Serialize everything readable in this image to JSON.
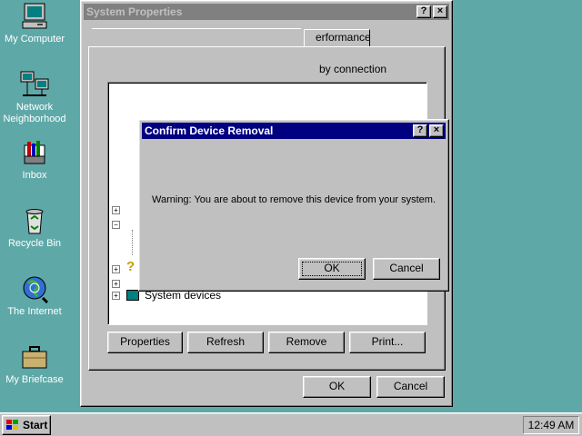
{
  "desktop": {
    "icons": [
      {
        "name": "computer-icon",
        "label": "My Computer"
      },
      {
        "name": "network-icon",
        "label": "Network\nNeighborhood"
      },
      {
        "name": "inbox-icon",
        "label": "Inbox"
      },
      {
        "name": "recycle-bin-icon",
        "label": "Recycle Bin"
      },
      {
        "name": "internet-icon",
        "label": "The Internet"
      },
      {
        "name": "briefcase-icon",
        "label": "My Briefcase"
      }
    ]
  },
  "system_properties": {
    "title": "System Properties",
    "help_btn": "?",
    "close_btn": "×",
    "tab_label": "erformance",
    "sort_text": "by connection",
    "tree_item": "System devices",
    "buttons": {
      "properties": "Properties",
      "refresh": "Refresh",
      "remove": "Remove",
      "print": "Print..."
    },
    "ok": "OK",
    "cancel": "Cancel",
    "partial_label": "S"
  },
  "confirm_dialog": {
    "title": "Confirm Device Removal",
    "help_btn": "?",
    "close_btn": "×",
    "message": "Warning: You are about to remove this device from your system.",
    "ok": "OK",
    "cancel": "Cancel"
  },
  "taskbar": {
    "start_label": "Start",
    "clock": "12:49 AM"
  },
  "colors": {
    "desktop": "#5FA8A8",
    "active_title": "#000080",
    "inactive_title": "#808080",
    "face": "#C0C0C0"
  }
}
